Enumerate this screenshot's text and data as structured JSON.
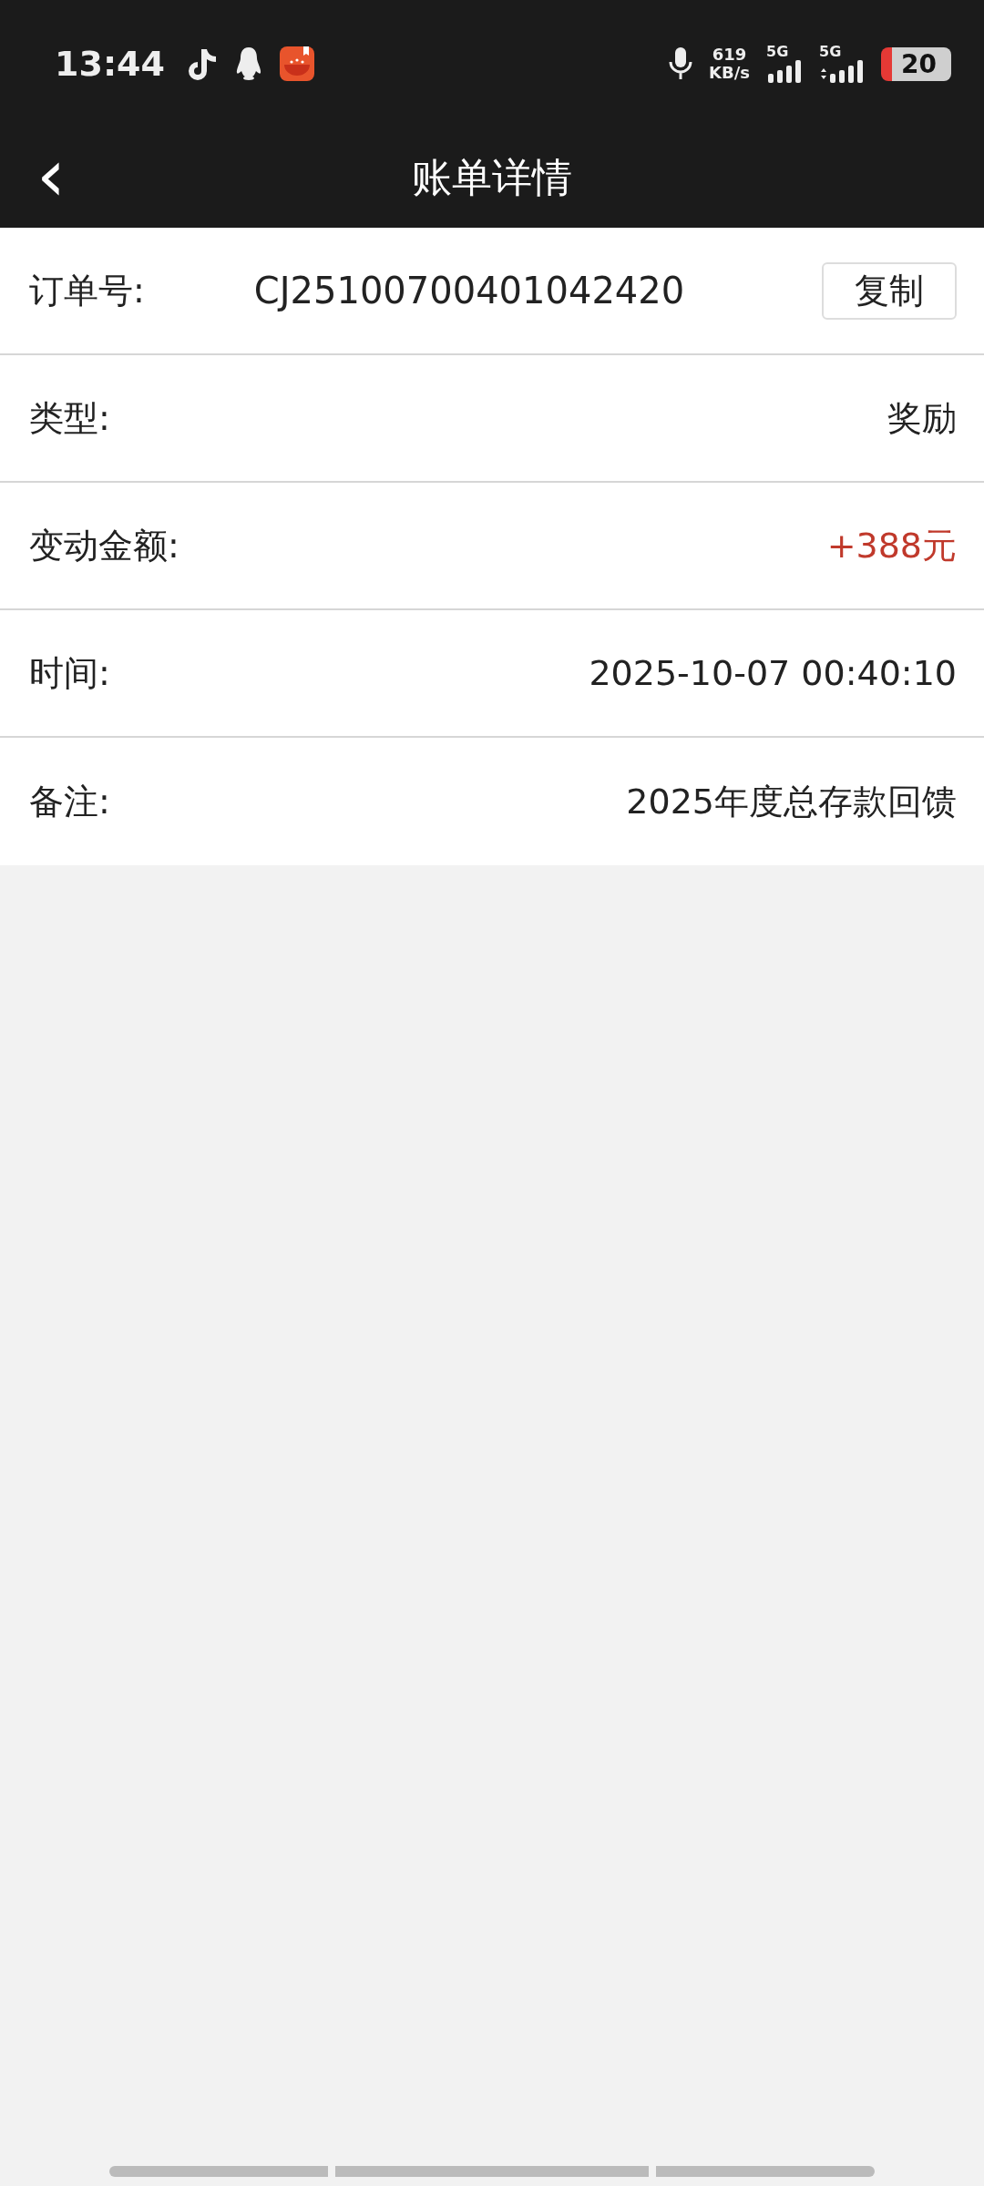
{
  "status_bar": {
    "time": "13:44",
    "net_speed": "619",
    "net_unit": "KB/s",
    "sim1": "5G",
    "sim2": "5G",
    "battery": "20"
  },
  "nav": {
    "back": "‹",
    "title": "账单详情"
  },
  "rows": [
    {
      "kind": "copy",
      "label": "订单号:",
      "value": "CJ25100700401042420",
      "button": "复制"
    },
    {
      "kind": "plain",
      "label": "类型:",
      "value": "奖励"
    },
    {
      "kind": "amount",
      "label": "变动金额:",
      "value": "+388元"
    },
    {
      "kind": "plain",
      "label": "时间:",
      "value": "2025-10-07 00:40:10"
    },
    {
      "kind": "plain",
      "label": "备注:",
      "value": "2025年度总存款回馈"
    }
  ]
}
